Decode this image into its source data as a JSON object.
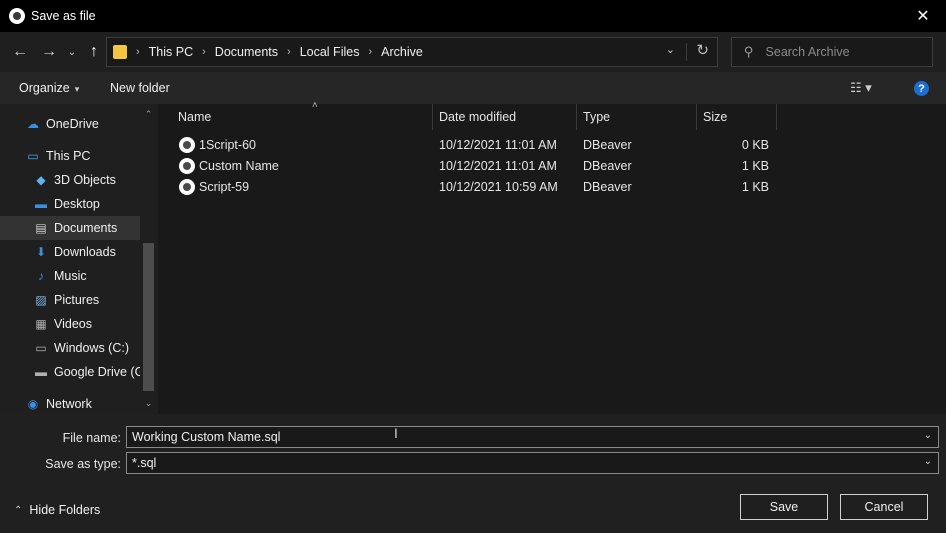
{
  "window": {
    "title": "Save as file",
    "close_glyph": "✕",
    "app_icon": "dbeaver-icon"
  },
  "nav": {
    "back_glyph": "←",
    "forward_glyph": "→",
    "recent_glyph": "⌄",
    "up_glyph": "↑",
    "breadcrumbs": [
      "This PC",
      "Documents",
      "Local Files",
      "Archive"
    ],
    "breadcrumb_sep": "›",
    "address_dropdown_glyph": "⌄",
    "refresh_glyph": "↻",
    "search_glyph": "⚲",
    "search_placeholder": "Search Archive"
  },
  "toolbar": {
    "organize_label": "Organize",
    "organize_caret": "▾",
    "new_folder_label": "New folder",
    "view_glyph": "☷ ▾",
    "help_glyph": "?"
  },
  "sidebar": {
    "items": [
      {
        "label": "OneDrive",
        "icon": "cloud-icon",
        "glyph": "☁",
        "color": "#3a8fe0"
      },
      {
        "label": "This PC",
        "icon": "computer-icon",
        "glyph": "▭",
        "color": "#4aa3ff"
      },
      {
        "label": "3D Objects",
        "icon": "cube-icon",
        "glyph": "◆",
        "color": "#5ab4f0"
      },
      {
        "label": "Desktop",
        "icon": "desktop-icon",
        "glyph": "▬",
        "color": "#3a8fe0"
      },
      {
        "label": "Documents",
        "icon": "document-icon",
        "glyph": "▤",
        "color": "#d0d0d0"
      },
      {
        "label": "Downloads",
        "icon": "download-icon",
        "glyph": "⬇",
        "color": "#3a8fe0"
      },
      {
        "label": "Music",
        "icon": "music-icon",
        "glyph": "♪",
        "color": "#3a8fe0"
      },
      {
        "label": "Pictures",
        "icon": "pictures-icon",
        "glyph": "▨",
        "color": "#7fb6e8"
      },
      {
        "label": "Videos",
        "icon": "video-icon",
        "glyph": "▦",
        "color": "#b0b0b0"
      },
      {
        "label": "Windows (C:)",
        "icon": "drive-icon",
        "glyph": "▭",
        "color": "#b0b0b0"
      },
      {
        "label": "Google Drive (G:",
        "icon": "drive-icon",
        "glyph": "▬",
        "color": "#b0b0b0"
      },
      {
        "label": "Network",
        "icon": "network-icon",
        "glyph": "◉",
        "color": "#3a8fe0"
      }
    ],
    "scroll_up_glyph": "⌃",
    "scroll_down_glyph": "⌄"
  },
  "filelist": {
    "columns": [
      "Name",
      "Date modified",
      "Type",
      "Size"
    ],
    "sort_glyph": "˄",
    "rows": [
      {
        "name": "1Script-60",
        "date": "10/12/2021 11:01 AM",
        "type": "DBeaver",
        "size": "0 KB"
      },
      {
        "name": "Custom Name",
        "date": "10/12/2021 11:01 AM",
        "type": "DBeaver",
        "size": "1 KB"
      },
      {
        "name": "Script-59",
        "date": "10/12/2021 10:59 AM",
        "type": "DBeaver",
        "size": "1 KB"
      }
    ]
  },
  "form": {
    "file_name_label": "File name:",
    "file_name_value": "Working Custom Name.sql",
    "save_type_label": "Save as type:",
    "save_type_value": "*.sql",
    "dropdown_glyph": "⌄",
    "cursor_glyph": "I"
  },
  "footer": {
    "hide_folders_glyph": "⌃",
    "hide_folders_label": "Hide Folders",
    "save_label": "Save",
    "cancel_label": "Cancel"
  },
  "colors": {
    "background": "#1f1f1f",
    "titlebar": "#000000",
    "selection": "#333333",
    "help_blue": "#1a6fd0",
    "folder_yellow": "#f4c542"
  }
}
